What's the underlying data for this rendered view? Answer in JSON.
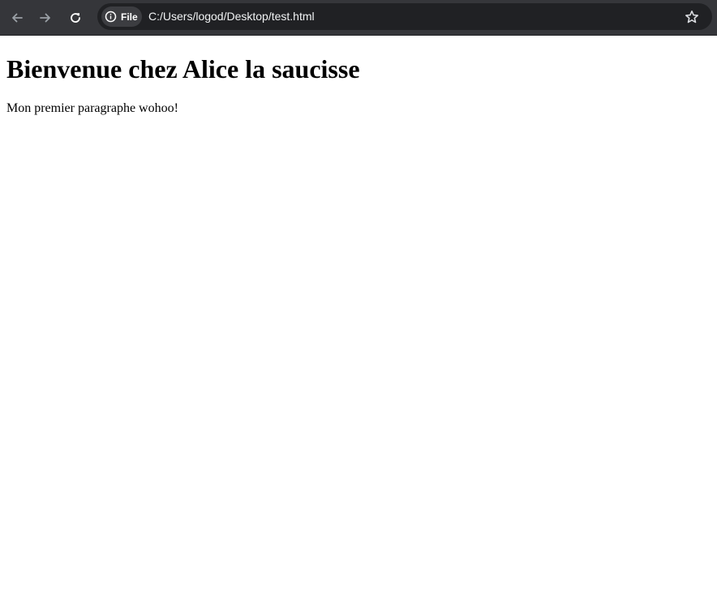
{
  "browser": {
    "back_icon": "arrow-left-icon",
    "forward_icon": "arrow-right-icon",
    "reload_icon": "reload-icon",
    "address_bar": {
      "chip_icon": "info-icon",
      "chip_label": "File",
      "url": "C:/Users/logod/Desktop/test.html",
      "bookmark_icon": "star-icon"
    },
    "colors": {
      "toolbar_bg": "#35363a",
      "omnibox_bg": "#202124",
      "chip_bg": "#3c3d41",
      "icon_color": "#dadce0",
      "disabled_icon_color": "#9aa0a6"
    }
  },
  "page": {
    "heading": "Bienvenue chez Alice la saucisse",
    "paragraph": "Mon premier paragraphe wohoo!"
  }
}
